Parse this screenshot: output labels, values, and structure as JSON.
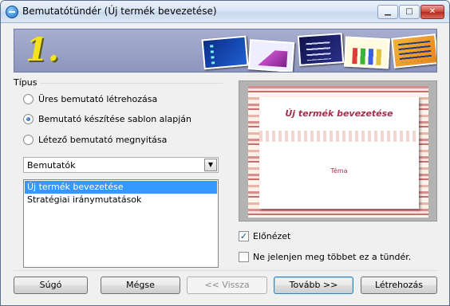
{
  "window": {
    "title": "Bemutatótündér (Új termék bevezetése)",
    "controls": {
      "minimize": "▁",
      "maximize": "□",
      "close": "✕"
    }
  },
  "banner": {
    "step": "1."
  },
  "type_group": {
    "label": "Típus",
    "options": [
      {
        "label": "Üres bemutató létrehozása",
        "checked": false
      },
      {
        "label": "Bemutató készítése sablon alapján",
        "checked": true
      },
      {
        "label": "Létező bemutató megnyitása",
        "checked": false
      }
    ]
  },
  "category_dropdown": {
    "value": "Bemutatók",
    "arrow": "▼"
  },
  "template_list": {
    "items": [
      "Új termék bevezetése",
      "Stratégiai iránymutatások"
    ],
    "selected_index": 0
  },
  "preview": {
    "slide_title": "Új termék bevezetése",
    "slide_subtitle": "Téma"
  },
  "options": {
    "preview_label": "Előnézet",
    "preview_checked": true,
    "preview_check_glyph": "✓",
    "dont_show_label": "Ne jelenjen meg többet ez a tündér.",
    "dont_show_checked": false
  },
  "buttons": {
    "help": "Súgó",
    "cancel": "Mégse",
    "back": "<< Vissza",
    "next": "Tovább >>",
    "create": "Létrehozás"
  }
}
